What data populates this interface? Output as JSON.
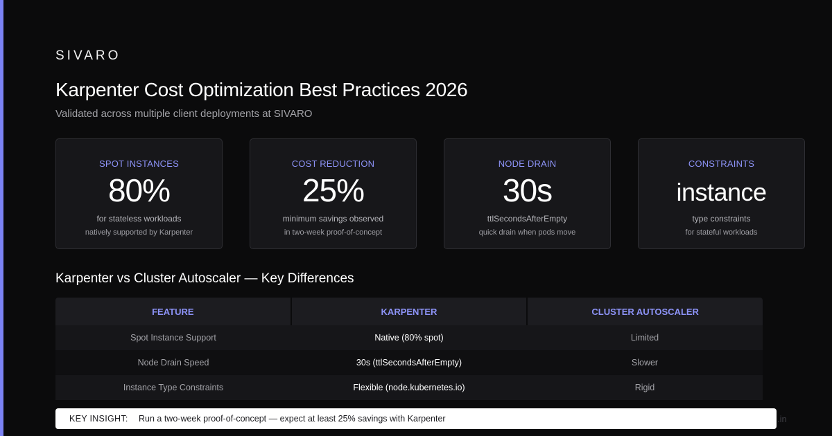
{
  "brand": "SIVARO",
  "title": "Karpenter Cost Optimization Best Practices 2026",
  "subtitle": "Validated across multiple client deployments at SIVARO",
  "cards": [
    {
      "label": "SPOT INSTANCES",
      "value": "80%",
      "desc": "for stateless workloads",
      "note": "natively supported by Karpenter"
    },
    {
      "label": "COST REDUCTION",
      "value": "25%",
      "desc": "minimum savings observed",
      "note": "in two-week proof-of-concept"
    },
    {
      "label": "NODE DRAIN",
      "value": "30s",
      "desc": "ttlSecondsAfterEmpty",
      "note": "quick drain when pods move"
    },
    {
      "label": "CONSTRAINTS",
      "value": "instance",
      "desc": "type constraints",
      "note": "for stateful workloads"
    }
  ],
  "section_title": "Karpenter vs Cluster Autoscaler — Key Differences",
  "table": {
    "headers": [
      "FEATURE",
      "KARPENTER",
      "CLUSTER AUTOSCALER"
    ],
    "rows": [
      [
        "Spot Instance Support",
        "Native (80% spot)",
        "Limited"
      ],
      [
        "Node Drain Speed",
        "30s (ttlSecondsAfterEmpty)",
        "Slower"
      ],
      [
        "Instance Type Constraints",
        "Flexible (node.kubernetes.io)",
        "Rigid"
      ]
    ]
  },
  "insight": {
    "label": "KEY INSIGHT:",
    "text": "Run a two-week proof-of-concept — expect at least 25% savings with Karpenter"
  },
  "footer_fragment": ".in",
  "colors": {
    "accent": "#7c83f5",
    "label": "#8d93f7",
    "background": "#0b0b0c",
    "card": "#17171a"
  }
}
